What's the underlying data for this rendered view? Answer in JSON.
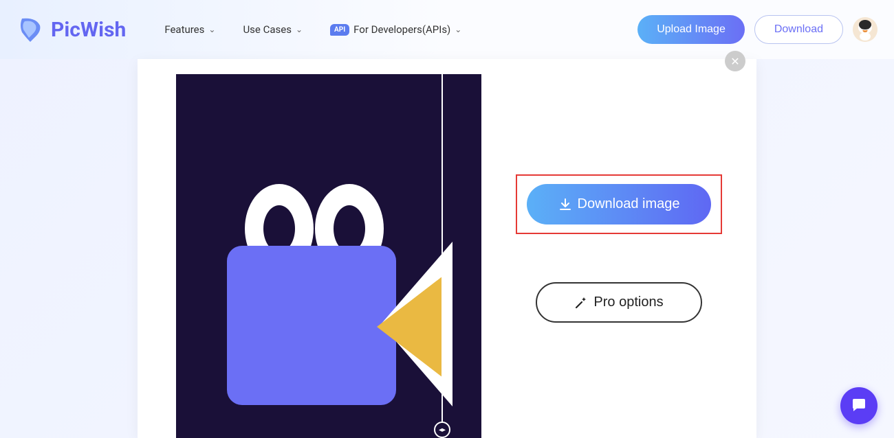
{
  "header": {
    "logo_text": "PicWish",
    "nav": {
      "features": "Features",
      "use_cases": "Use Cases",
      "developers": "For Developers(APIs)",
      "api_badge": "API"
    },
    "upload_button": "Upload Image",
    "download_button": "Download"
  },
  "panel": {
    "download_image_button": "Download image",
    "pro_options_button": "Pro options"
  },
  "colors": {
    "primary_purple": "#6b6ff5",
    "gradient_blue": "#5bb0f7",
    "highlight_red": "#e53935",
    "dark_bg": "#1a1038",
    "accent_yellow": "#eab942"
  }
}
